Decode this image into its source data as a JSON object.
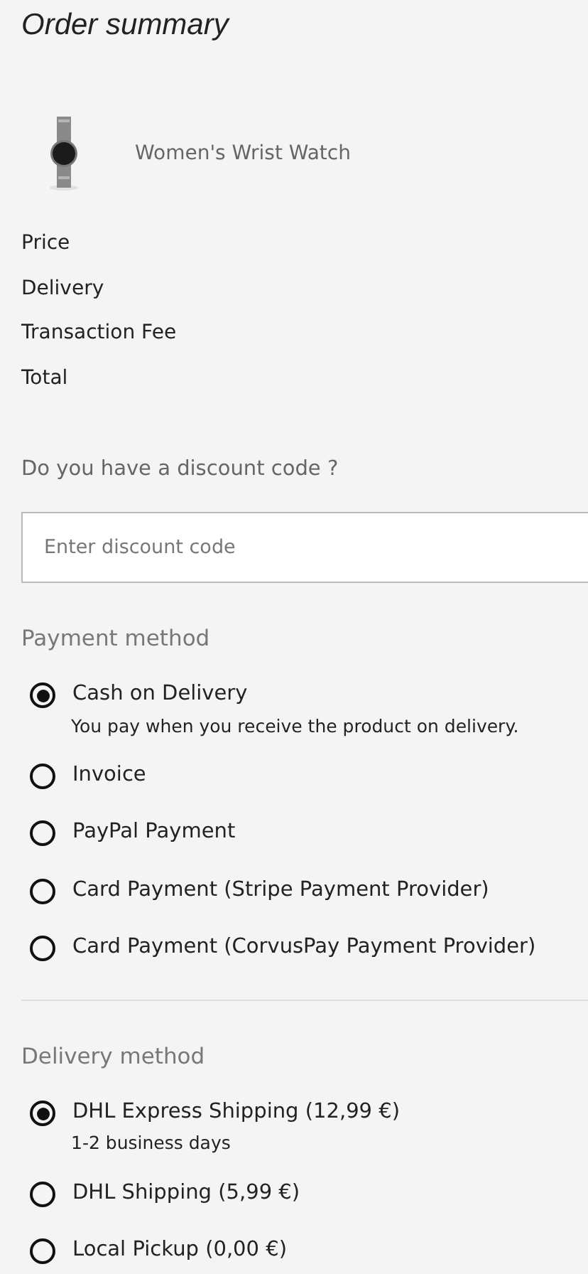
{
  "title": "Order summary",
  "product": {
    "name": "Women's Wrist Watch"
  },
  "summary_rows": [
    "Price",
    "Delivery",
    "Transaction Fee",
    "Total"
  ],
  "discount": {
    "label": "Do you have a discount code ?",
    "placeholder": "Enter discount code"
  },
  "payment": {
    "heading": "Payment method",
    "options": [
      {
        "label": "Cash on Delivery",
        "selected": true,
        "description": "You pay when you receive the product on delivery."
      },
      {
        "label": "Invoice",
        "selected": false
      },
      {
        "label": "PayPal Payment",
        "selected": false
      },
      {
        "label": "Card Payment (Stripe Payment Provider)",
        "selected": false
      },
      {
        "label": "Card Payment (CorvusPay Payment Provider)",
        "selected": false
      }
    ]
  },
  "delivery": {
    "heading": "Delivery method",
    "options": [
      {
        "label": "DHL Express Shipping (12,99 €)",
        "selected": true,
        "description": "1-2 business days"
      },
      {
        "label": "DHL Shipping (5,99 €)",
        "selected": false
      },
      {
        "label": "Local Pickup (0,00 €)",
        "selected": false
      }
    ]
  }
}
